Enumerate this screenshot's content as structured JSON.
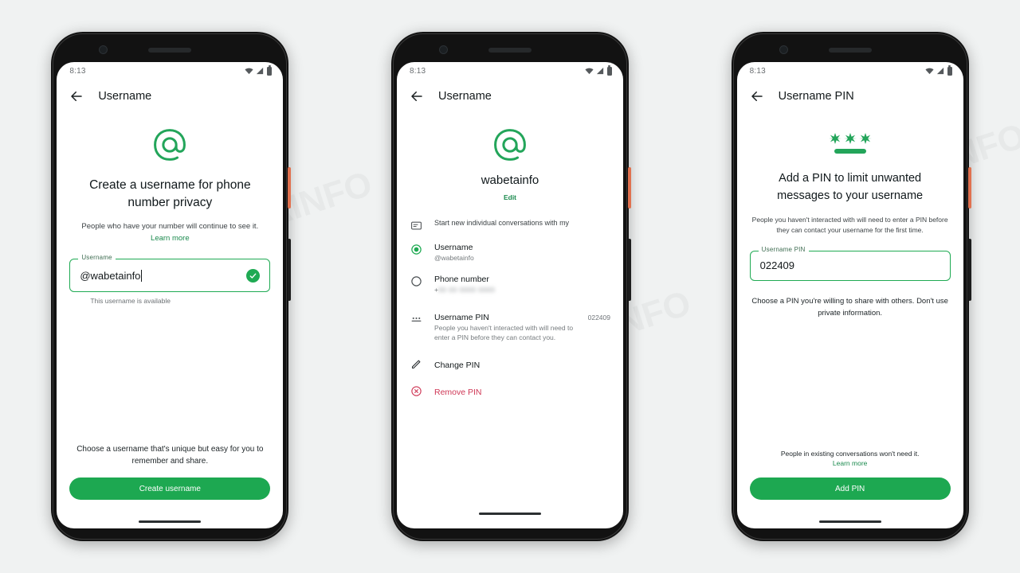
{
  "status_bar": {
    "time": "8:13",
    "icons": [
      "wifi-icon",
      "signal-icon",
      "battery-icon"
    ]
  },
  "theme": {
    "green": "#1da851",
    "green_dark": "#1b8a4e",
    "danger": "#cf3756",
    "page_bg": "#f0f2f2"
  },
  "phone1": {
    "appbar_title": "Username",
    "back_icon": "back-arrow-icon",
    "hero_icon": "at-sign-icon",
    "heading": "Create a username for phone number privacy",
    "subtext": "People who have your number will continue to see it.",
    "learn_more": "Learn more",
    "field": {
      "label": "Username",
      "value": "@wabetainfo",
      "valid_icon": "check-circle-icon",
      "helper": "This username is available"
    },
    "footer_note": "Choose a username that's unique but easy for you to remember and share.",
    "cta_label": "Create username"
  },
  "phone2": {
    "appbar_title": "Username",
    "back_icon": "back-arrow-icon",
    "hero_icon": "at-sign-icon",
    "username": "wabetainfo",
    "edit_label": "Edit",
    "section_caption": "Start new individual conversations with my",
    "section_caption_icon": "message-card-icon",
    "options": [
      {
        "icon": "radio-selected-icon",
        "label": "Username",
        "sub": "@wabetainfo",
        "selected": true
      },
      {
        "icon": "radio-unselected-icon",
        "label": "Phone number",
        "sub": "+",
        "sub_redacted": "00 00 0000 0000",
        "selected": false
      }
    ],
    "pin_row": {
      "icon": "password-dots-icon",
      "label": "Username PIN",
      "description": "People you haven't interacted with will need to enter a PIN before they can contact you.",
      "value": "022409"
    },
    "actions": [
      {
        "icon": "pencil-icon",
        "label": "Change PIN",
        "danger": false
      },
      {
        "icon": "remove-circle-icon",
        "label": "Remove PIN",
        "danger": true
      }
    ]
  },
  "phone3": {
    "appbar_title": "Username PIN",
    "back_icon": "back-arrow-icon",
    "hero_icon": "pin-asterisks-icon",
    "heading": "Add a PIN to limit unwanted messages to your username",
    "subtext": "People you haven't interacted with will need to enter a PIN before they can contact your username for the first time.",
    "field": {
      "label": "Username PIN",
      "value": "022409"
    },
    "note": "Choose a PIN you're willing to share with others. Don't use private information.",
    "bottom_note": "People in existing conversations won't need it.",
    "learn_more": "Learn more",
    "cta_label": "Add PIN"
  }
}
